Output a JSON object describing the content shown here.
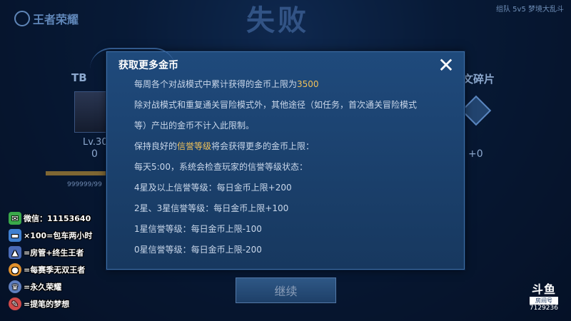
{
  "game": {
    "logo": "王者荣耀",
    "mode": "组队 5v5 梦境大乱斗",
    "result": "失败"
  },
  "background": {
    "left_tag": "TB",
    "left_level": "Lv.30",
    "left_zero": "0",
    "left_number": "999999/99",
    "right_tag": "文碎片",
    "right_plus": "+0"
  },
  "modal": {
    "title": "获取更多金币",
    "close_icon": "close-icon",
    "lines": {
      "l1_pre": "每周各个对战模式中累计获得的金币上限为",
      "l1_hl": "3500",
      "l2": "除对战模式和重复通关冒险模式外，其他途径（如任务，首次通关冒险模式",
      "l3": "等）产出的金币不计入此限制。",
      "l4_pre": "保持良好的",
      "l4_hl": "信誉等级",
      "l4_post": "将会获得更多的金币上限：",
      "l5": "每天5:00，系统会检查玩家的信誉等级状态：",
      "l6": "4星及以上信誉等级：每日金币上限+200",
      "l7": "2星、3星信誉等级：每日金币上限+100",
      "l8": "1星信誉等级：每日金币上限-100",
      "l9": "0星信誉等级：每日金币上限-200"
    },
    "highlight_color": "#f1c25a"
  },
  "continue_label": "继续",
  "streamer_overlay": [
    {
      "icon": "wechat-icon",
      "text": "微信：11153640"
    },
    {
      "icon": "car-icon",
      "text": "×100=包车两小时"
    },
    {
      "icon": "rocket-icon",
      "text": "=房管+终生王者"
    },
    {
      "icon": "medal-icon",
      "text": "=每赛季无双王者"
    },
    {
      "icon": "crown-icon",
      "text": "=永久荣耀"
    },
    {
      "icon": "pen-icon",
      "text": "=提笔的梦想"
    }
  ],
  "watermark": {
    "logo": "斗鱼",
    "tag": "房间号",
    "room": "7129236"
  }
}
